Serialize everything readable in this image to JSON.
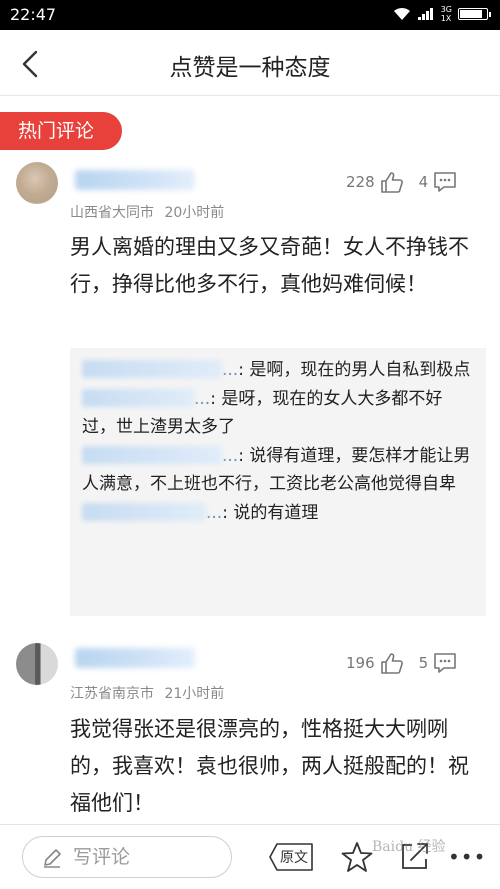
{
  "status_bar": {
    "time": "22:47",
    "network_top": "3G",
    "network_bottom": "1X"
  },
  "header": {
    "title": "点赞是一种态度",
    "back_icon": "chevron-left-icon"
  },
  "section": {
    "hot_label": "热门评论"
  },
  "comments": [
    {
      "location": "山西省大同市",
      "time": "20小时前",
      "likes": "228",
      "replies_count": "4",
      "text": "男人离婚的理由又多又奇葩！女人不挣钱不行，挣得比他多不行，真他妈难伺候！",
      "replies": [
        {
          "name_suffix": "...",
          "text": "是啊，现在的男人自私到极点"
        },
        {
          "name_suffix": "...",
          "text": "是呀，现在的女人大多都不好过，世上渣男太多了"
        },
        {
          "name_suffix": "...",
          "text": "说得有道理，要怎样才能让男人满意，不上班也不行，工资比老公高他觉得自卑"
        },
        {
          "name_suffix": "...",
          "text": "说的有道理"
        }
      ]
    },
    {
      "location": "江苏省南京市",
      "time": "21小时前",
      "likes": "196",
      "replies_count": "5",
      "text": "我觉得张还是很漂亮的，性格挺大大咧咧的，我喜欢！袁也很帅，两人挺般配的！祝福他们！"
    }
  ],
  "bottom_bar": {
    "write_placeholder": "写评论",
    "original_label": "原文",
    "more_label": "•••",
    "watermark": "Baidu 经验"
  },
  "colors": {
    "accent": "#e8403a",
    "muted": "#8a8a8a",
    "reply_bg": "#f4f4f4"
  }
}
